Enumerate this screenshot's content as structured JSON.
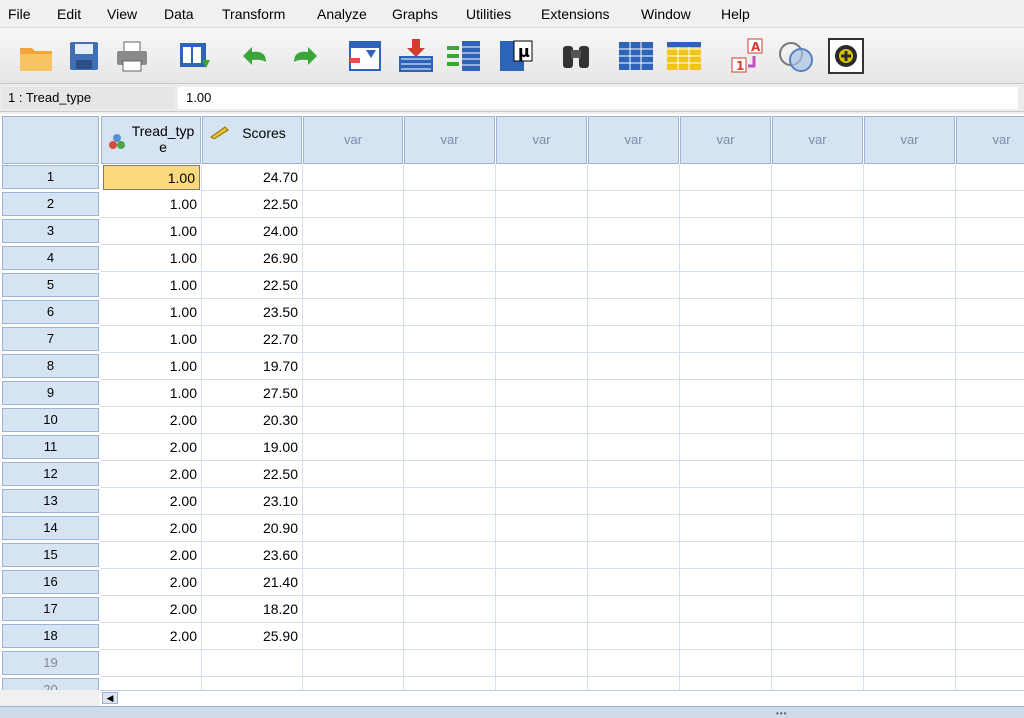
{
  "menu": [
    "File",
    "Edit",
    "View",
    "Data",
    "Transform",
    "Analyze",
    "Graphs",
    "Utilities",
    "Extensions",
    "Window",
    "Help"
  ],
  "toolbar": {
    "icons": [
      "open-folder-icon",
      "save-icon",
      "print-icon",
      "recall-dialog-icon",
      "undo-icon",
      "redo-icon",
      "go-to-case-icon",
      "insert-cases-icon",
      "insert-variable-icon",
      "descriptives-icon",
      "find-icon",
      "split-file-icon",
      "select-cases-icon",
      "value-labels-icon",
      "use-sets-icon",
      "spelling-icon"
    ]
  },
  "cell_editor": {
    "reference": "1 : Tread_type",
    "value": "1.00"
  },
  "grid": {
    "columns": [
      {
        "label": "Tread_typ\ne",
        "type": "nominal"
      },
      {
        "label": "Scores",
        "type": "scale"
      },
      {
        "label": "var"
      },
      {
        "label": "var"
      },
      {
        "label": "var"
      },
      {
        "label": "var"
      },
      {
        "label": "var"
      },
      {
        "label": "var"
      },
      {
        "label": "var"
      },
      {
        "label": "var"
      }
    ],
    "row_labels": [
      "1",
      "2",
      "3",
      "4",
      "5",
      "6",
      "7",
      "8",
      "9",
      "10",
      "11",
      "12",
      "13",
      "14",
      "15",
      "16",
      "17",
      "18",
      "19",
      "20"
    ],
    "rows": [
      [
        "1.00",
        "24.70"
      ],
      [
        "1.00",
        "22.50"
      ],
      [
        "1.00",
        "24.00"
      ],
      [
        "1.00",
        "26.90"
      ],
      [
        "1.00",
        "22.50"
      ],
      [
        "1.00",
        "23.50"
      ],
      [
        "1.00",
        "22.70"
      ],
      [
        "1.00",
        "19.70"
      ],
      [
        "1.00",
        "27.50"
      ],
      [
        "2.00",
        "20.30"
      ],
      [
        "2.00",
        "19.00"
      ],
      [
        "2.00",
        "22.50"
      ],
      [
        "2.00",
        "23.10"
      ],
      [
        "2.00",
        "20.90"
      ],
      [
        "2.00",
        "23.60"
      ],
      [
        "2.00",
        "21.40"
      ],
      [
        "2.00",
        "18.20"
      ],
      [
        "2.00",
        "25.90"
      ]
    ],
    "selected_cell": {
      "row": 1,
      "column": "Tread_type"
    }
  },
  "colors": {
    "header_bg": "#d6e3f2",
    "selected_cell": "#fbd97e",
    "grid_line": "#d4dfec"
  }
}
